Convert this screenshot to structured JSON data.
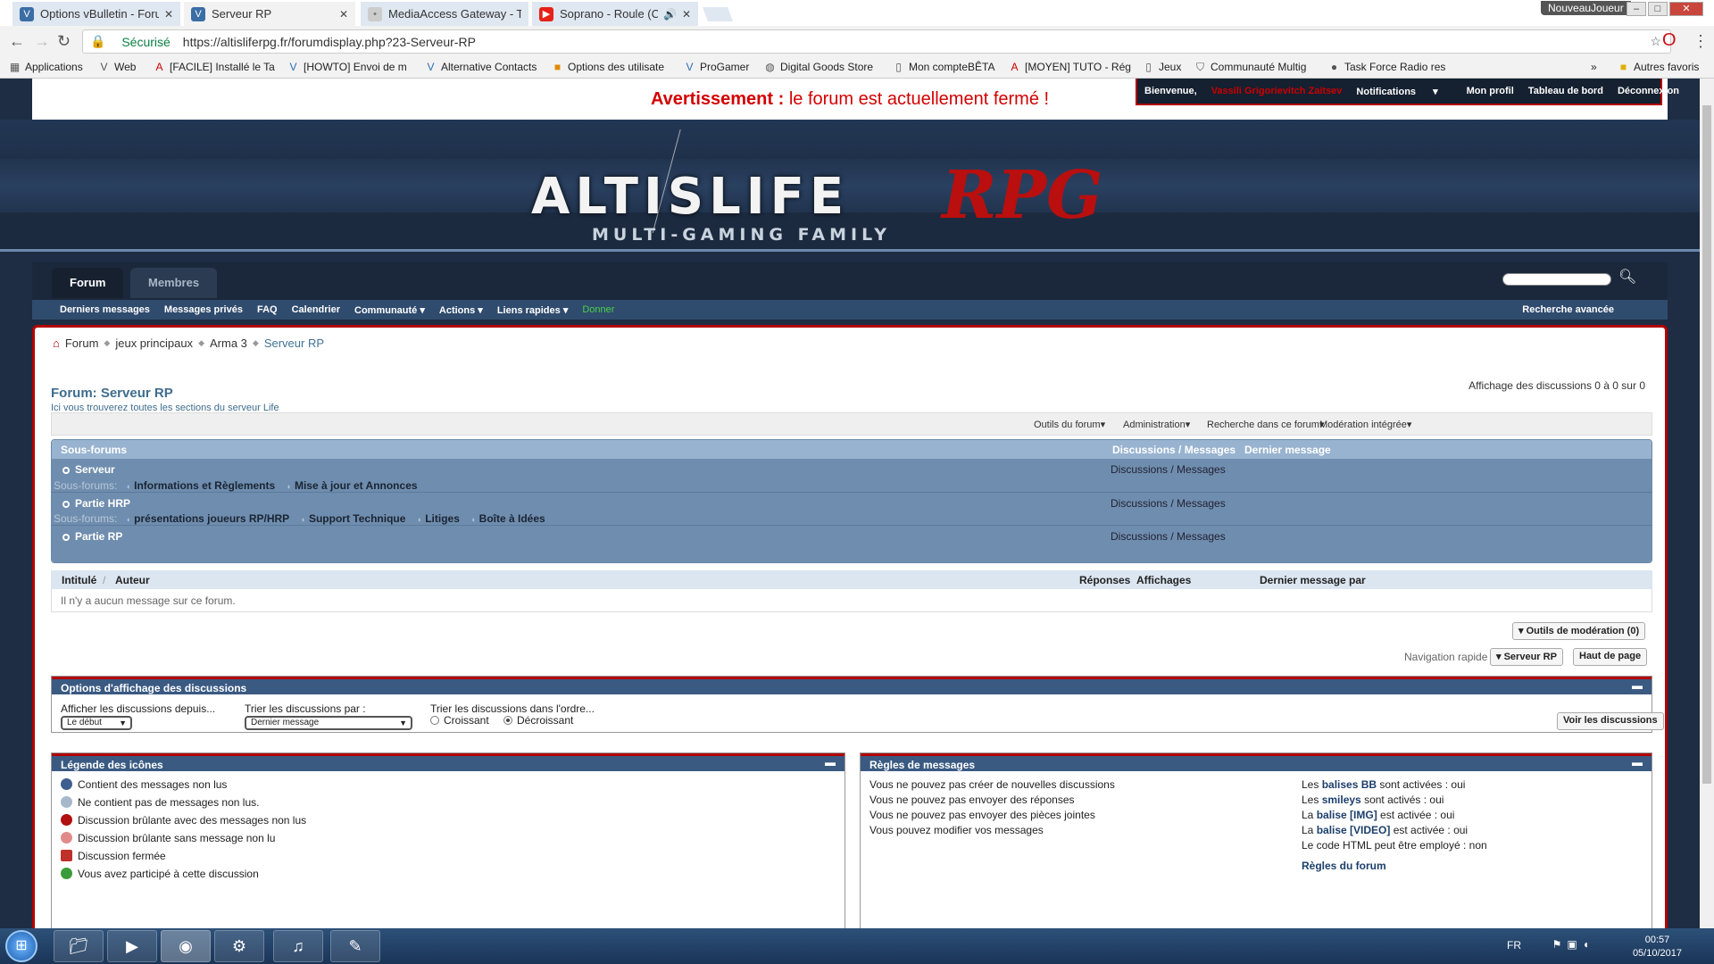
{
  "browser": {
    "tabs": [
      {
        "title": "Options vBulletin - Forun",
        "icon_color": "#3a6ea5",
        "icon": "V"
      },
      {
        "title": "Serveur RP",
        "icon_color": "#3a6ea5",
        "icon": "V"
      },
      {
        "title": "MediaAccess Gateway - T",
        "icon_color": "#cccccc",
        "icon": "•"
      },
      {
        "title": "Soprano - Roule (Clip",
        "icon_color": "#e62117",
        "icon": "▶"
      }
    ],
    "active_tab_index": 1,
    "user_badge": "NouveauJoueur",
    "secure_label": "Sécurisé",
    "url": "https://altisliferpg.fr/forumdisplay.php?23-Serveur-RP",
    "bookmarks": [
      "Applications",
      "Web",
      "[FACILE] Installé le Ta",
      "[HOWTO] Envoi de m",
      "Alternative Contacts",
      "Options des utilisate",
      "ProGamer",
      "Digital Goods Store",
      "Mon compteBÊTA",
      "[MOYEN] TUTO - Rég",
      "Jeux",
      "Communauté Multig",
      "Task Force Radio res"
    ],
    "more_bookmarks": "»",
    "other_bookmarks": "Autres favoris"
  },
  "notice": {
    "label": "Avertissement :",
    "text": "le forum est actuellement fermé !"
  },
  "userbar": {
    "welcome": "Bienvenue,",
    "username": "Vassili Grigorievitch Zaitsev",
    "notifications": "Notifications",
    "profile": "Mon profil",
    "dashboard": "Tableau de bord",
    "logout": "Déconnexion"
  },
  "logo": {
    "main": "ALTISLIFE",
    "rpg": "RPG",
    "sub": "MULTI-GAMING FAMILY"
  },
  "nav": {
    "tabs": [
      "Forum",
      "Membres"
    ],
    "sub": [
      "Derniers messages",
      "Messages privés",
      "FAQ",
      "Calendrier",
      "Communauté",
      "Actions",
      "Liens rapides"
    ],
    "donate": "Donner",
    "advanced_search": "Recherche avancée"
  },
  "breadcrumb": [
    "Forum",
    "jeux principaux",
    "Arma 3",
    "Serveur RP"
  ],
  "forum": {
    "title": "Forum: Serveur RP",
    "description": "Ici vous trouverez toutes les sections du serveur Life",
    "thread_count": "Affichage des discussions 0 à 0 sur 0",
    "tools": [
      "Outils du forum",
      "Administration",
      "Recherche dans ce forum",
      "Modération intégrée"
    ]
  },
  "subforums": {
    "header": {
      "name": "Sous-forums",
      "counts": "Discussions / Messages",
      "last": "Dernier message"
    },
    "sub_label": "Sous-forums:",
    "rows": [
      {
        "name": "Serveur",
        "counts": "Discussions / Messages",
        "subs": [
          "Informations et Règlements",
          "Mise à jour et Annonces"
        ]
      },
      {
        "name": "Partie HRP",
        "counts": "Discussions / Messages",
        "subs": [
          "présentations joueurs RP/HRP",
          "Support Technique",
          "Litiges",
          "Boîte à Idées"
        ]
      },
      {
        "name": "Partie RP",
        "counts": "Discussions / Messages",
        "subs": []
      }
    ]
  },
  "threads": {
    "columns": {
      "title": "Intitulé",
      "author": "Auteur",
      "replies": "Réponses",
      "views": "Affichages",
      "last": "Dernier message par"
    },
    "empty": "Il n'y a aucun message sur ce forum."
  },
  "mod_tools": "Outils de modération (0)",
  "quicknav": {
    "label": "Navigation rapide",
    "current": "Serveur RP",
    "top": "Haut de page"
  },
  "display_options": {
    "title": "Options d'affichage des discussions",
    "since_label": "Afficher les discussions depuis...",
    "since_value": "Le début",
    "sort_label": "Trier les discussions par :",
    "sort_value": "Dernier message",
    "order_label": "Trier les discussions dans l'ordre...",
    "asc": "Croissant",
    "desc": "Décroissant",
    "order_selected": "desc",
    "submit": "Voir les discussions"
  },
  "legend": {
    "title": "Légende des icônes",
    "items": [
      {
        "text": "Contient des messages non lus",
        "color": "#3d5f8f"
      },
      {
        "text": "Ne contient pas de messages non lus.",
        "color": "#a7b8cc"
      },
      {
        "text": "Discussion brûlante avec des messages non lus",
        "color": "#b01010"
      },
      {
        "text": "Discussion brûlante sans message non lu",
        "color": "#e08a8a"
      },
      {
        "text": "Discussion fermée",
        "color": "#c0302a"
      },
      {
        "text": "Vous avez participé à cette discussion",
        "color": "#3a9b3a"
      }
    ]
  },
  "rules": {
    "title": "Règles de messages",
    "left": [
      "Vous ne pouvez pas créer de nouvelles discussions",
      "Vous ne pouvez pas envoyer des réponses",
      "Vous ne pouvez pas envoyer des pièces jointes",
      "Vous pouvez modifier vos messages"
    ],
    "right": [
      {
        "pre": "Les ",
        "b": "balises BB",
        "post": " sont activées : oui"
      },
      {
        "pre": "Les ",
        "b": "smileys",
        "post": " sont activés : oui"
      },
      {
        "pre": "La ",
        "b": "balise [IMG]",
        "post": " est activée : oui"
      },
      {
        "pre": "La ",
        "b": "balise [VIDEO]",
        "post": " est activée : oui"
      },
      {
        "pre": "Le code HTML peut être employé : non",
        "b": "",
        "post": ""
      }
    ],
    "link": "Règles du forum"
  },
  "taskbar": {
    "lang": "FR",
    "time": "00:57",
    "date": "05/10/2017"
  }
}
